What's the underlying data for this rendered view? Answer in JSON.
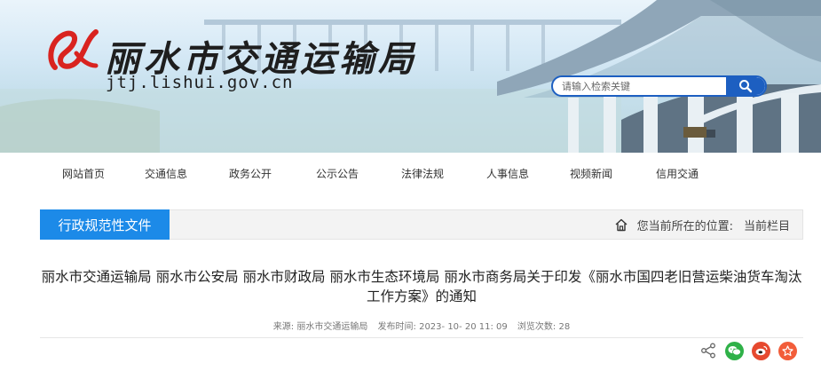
{
  "header": {
    "site_title": "丽水市交通运输局",
    "site_domain": "jtj.lishui.gov.cn",
    "search": {
      "placeholder": "请输入检索关键"
    }
  },
  "nav": {
    "items": [
      {
        "label": "网站首页"
      },
      {
        "label": "交通信息"
      },
      {
        "label": "政务公开"
      },
      {
        "label": "公示公告"
      },
      {
        "label": "法律法规"
      },
      {
        "label": "人事信息"
      },
      {
        "label": "视频新闻"
      },
      {
        "label": "信用交通"
      }
    ]
  },
  "column": {
    "tab_label": "行政规范性文件",
    "location_label": "您当前所在的位置:",
    "location_value": "当前栏目"
  },
  "article": {
    "title": "丽水市交通运输局 丽水市公安局 丽水市财政局 丽水市生态环境局 丽水市商务局关于印发《丽水市国四老旧营运柴油货车淘汰工作方案》的通知",
    "source": "来源: 丽水市交通运输局",
    "publish_time": "发布时间: 2023- 10- 20 11: 09",
    "views": "浏览次数: 28"
  },
  "share": {
    "icons": [
      "share-icon",
      "wechat-icon",
      "weibo-icon",
      "favorite-icon"
    ]
  },
  "colors": {
    "accent_blue": "#1c8ae8",
    "search_blue": "#1d5fc1",
    "logo_red": "#d9231f",
    "wechat_green": "#2fb148",
    "weibo_red": "#e6492f",
    "favorite_orange": "#f25d3a"
  }
}
